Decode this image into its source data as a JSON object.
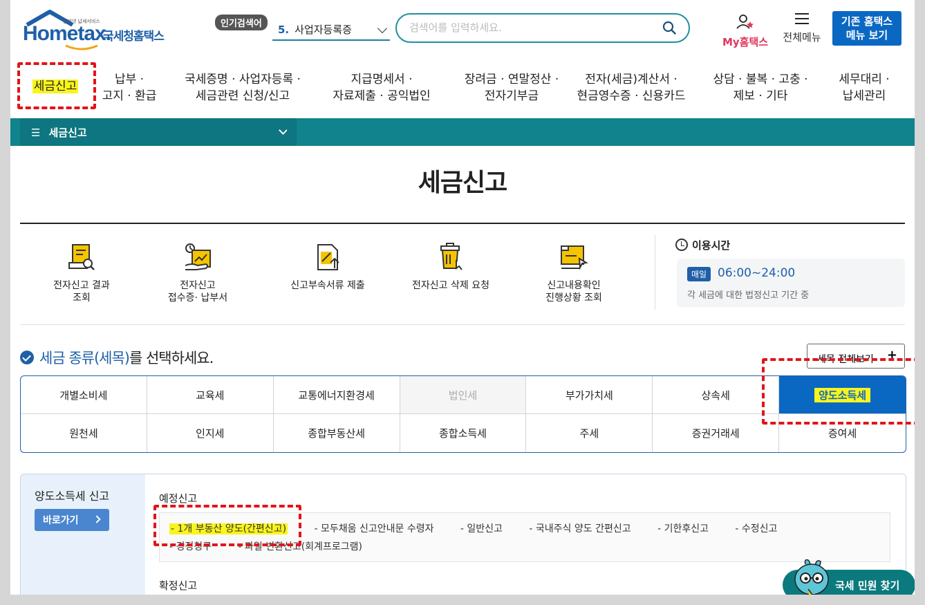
{
  "header": {
    "logo_tagline": "인터넷 납세서비스",
    "logo_word": "Hometax.",
    "logo_sub": "국세청홈택스",
    "popular_label": "인기검색어",
    "popular_rank": "5.",
    "popular_term": "사업자등록증",
    "search_placeholder": "검색어를 입력하세요.",
    "my_label": "My홈택스",
    "menu_label": "전체메뉴",
    "old_home_line1": "기존 홈택스",
    "old_home_line2": "메뉴 보기"
  },
  "nav": {
    "items": [
      {
        "line1": "세금신고",
        "line2": ""
      },
      {
        "line1": "납부 ·",
        "line2": "고지 · 환급"
      },
      {
        "line1": "국세증명 · 사업자등록 ·",
        "line2": "세금관련 신청/신고"
      },
      {
        "line1": "지급명세서 ·",
        "line2": "자료제출 · 공익법인"
      },
      {
        "line1": "장려금 · 연말정산 ·",
        "line2": "전자기부금"
      },
      {
        "line1": "전자(세금)계산서 ·",
        "line2": "현금영수증 · 신용카드"
      },
      {
        "line1": "상담 · 불복 · 고충 ·",
        "line2": "제보 · 기타"
      },
      {
        "line1": "세무대리 ·",
        "line2": "납세관리"
      }
    ]
  },
  "breadcrumb": {
    "menu_mark": "☰",
    "label": "세금신고"
  },
  "page": {
    "title": "세금신고"
  },
  "quick_links": [
    {
      "line1": "전자신고 결과",
      "line2": "조회",
      "icon": "report-search-icon"
    },
    {
      "line1": "전자신고",
      "line2": "접수증· 납부서",
      "icon": "receipt-hand-icon"
    },
    {
      "line1": "신고부속서류 제출",
      "line2": "",
      "icon": "document-upload-icon"
    },
    {
      "line1": "전자신고 삭제 요청",
      "line2": "",
      "icon": "trash-click-icon"
    },
    {
      "line1": "신고내용확인",
      "line2": "진행상황 조회",
      "icon": "monitor-cursor-icon"
    }
  ],
  "hours": {
    "title": "이용시간",
    "badge": "매일",
    "value": "06:00~24:00",
    "note": "각 세금에 대한 법정신고 기간 중"
  },
  "selector": {
    "heading_blue": "세금 종류(세목)",
    "heading_rest": "를 선택하세요.",
    "all_button": "세목 전체보기",
    "taxes_row1": [
      "개별소비세",
      "교육세",
      "교통에너지환경세",
      "법인세",
      "부가가치세",
      "상속세",
      "양도소득세"
    ],
    "taxes_row2": [
      "원천세",
      "인지세",
      "종합부동산세",
      "종합소득세",
      "주세",
      "증권거래세",
      "증여세"
    ],
    "active": "양도소득세",
    "disabled": "법인세"
  },
  "panel": {
    "title": "양도소득세 신고",
    "go_button": "바로가기",
    "pre_title": "예정신고",
    "pre_items_row1": [
      "- 1개 부동산 양도(간편신고)",
      "- 모두채움 신고안내문 수령자",
      "- 일반신고",
      "- 국내주식 양도 간편신고",
      "- 기한후신고",
      "- 수정신고"
    ],
    "pre_items_row2": [
      "- 경정청구",
      "- 파일 변환신고(회계프로그램)"
    ],
    "final_title": "확정신고"
  },
  "chat": {
    "label": "국세 민원 찾기"
  },
  "colors": {
    "brand_blue": "#1f5fa8",
    "teal": "#10838d",
    "active_tab": "#0b68c2",
    "highlight": "#f9f41c",
    "annotation_red": "#e0151b"
  }
}
